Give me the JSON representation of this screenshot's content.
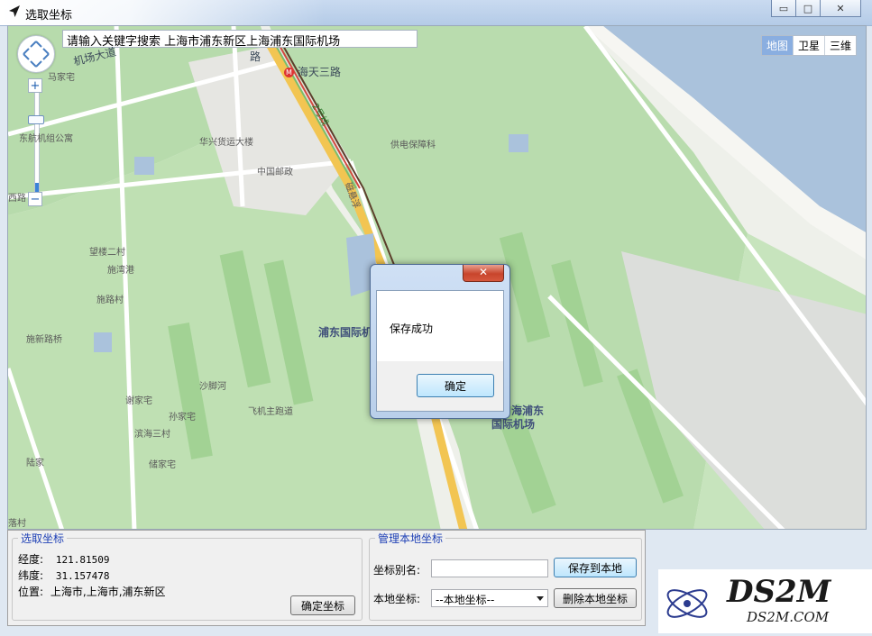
{
  "window": {
    "title": "选取坐标",
    "minimize": "▭",
    "maximize": "□",
    "close": "✕"
  },
  "map": {
    "search_text": "请输入关键字搜索 上海市浦东新区上海浦东国际机场",
    "types": [
      "地图",
      "卫星",
      "三维"
    ],
    "active_type": "地图",
    "zoom_level_fraction": 0.15,
    "labels": {
      "road1": "机场大道",
      "road2": "路",
      "metro": "海天三路",
      "place1": "马家宅",
      "place2": "东航机组公寓",
      "place3": "华兴货运大楼",
      "place4": "供电保障科",
      "place5": "中国邮政",
      "place6": "西路",
      "line": "磁悬浮",
      "line2": "2号线",
      "place7": "望楼二村",
      "place8": "施湾港",
      "place9": "施路村",
      "airport": "浦东国际机",
      "place10": "施新路桥",
      "place11": "沙脚河",
      "place12": "谢家宅",
      "place13": "飞机主跑道",
      "place14": "孙家宅",
      "place15": "滨海三村",
      "place16": "储家宅",
      "place17": "陆家",
      "place18": "落村",
      "airport2a": "海浦东",
      "airport2b": "国际机场"
    }
  },
  "dialog": {
    "close": "✕",
    "message": "保存成功",
    "ok": "确定"
  },
  "pick": {
    "title": "选取坐标",
    "lng_label": "经度:",
    "lng_value": "121.81509",
    "lat_label": "纬度:",
    "lat_value": "31.157478",
    "loc_label": "位置:",
    "loc_value": "上海市,上海市,浦东新区",
    "confirm_button": "确定坐标"
  },
  "manage": {
    "title": "管理本地坐标",
    "alias_label": "坐标别名:",
    "alias_value": "",
    "save_button": "保存到本地",
    "local_label": "本地坐标:",
    "local_selected": "--本地坐标--",
    "delete_button": "删除本地坐标"
  },
  "watermark": {
    "logo": "DS2M",
    "url": "DS2M.COM"
  },
  "colors": {
    "green_area": "#a9d79c",
    "water": "#aac2dc",
    "road": "#ffffff",
    "maglev": "#f2c552",
    "group_title": "#1d3fb5"
  }
}
